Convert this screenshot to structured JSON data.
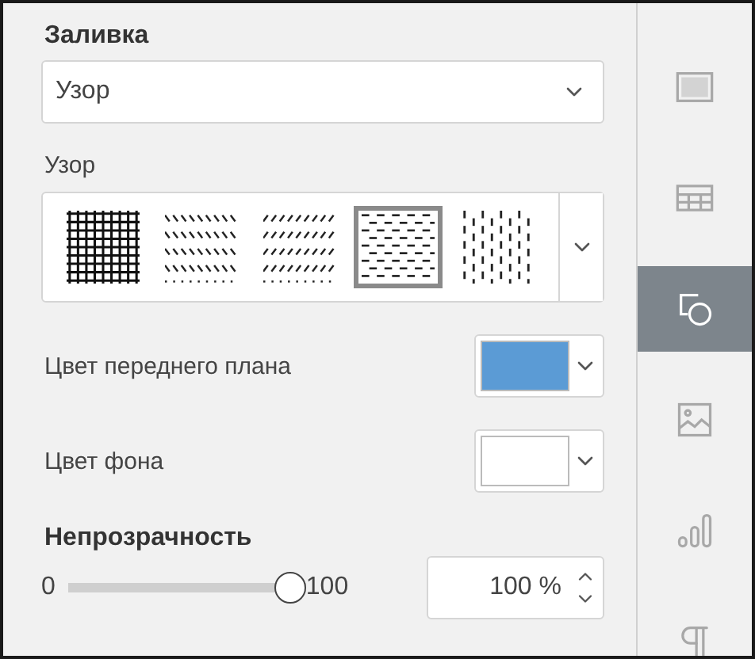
{
  "fill": {
    "title": "Заливка",
    "type_select": {
      "value": "Узор"
    }
  },
  "pattern": {
    "label": "Узор",
    "items": [
      {
        "kind": "grid",
        "selected": false
      },
      {
        "kind": "diagonal-down",
        "selected": false
      },
      {
        "kind": "diagonal-up",
        "selected": false
      },
      {
        "kind": "dashed-horizontal",
        "selected": true
      },
      {
        "kind": "dashed-vertical",
        "selected": false
      }
    ]
  },
  "foreground": {
    "label": "Цвет переднего плана",
    "color": "#5b9bd5"
  },
  "background": {
    "label": "Цвет фона",
    "color": "#ffffff"
  },
  "opacity": {
    "title": "Непрозрачность",
    "min": "0",
    "max": "100",
    "level": 1,
    "value": "100 %"
  },
  "sidebar": [
    {
      "kind": "slide",
      "selected": false
    },
    {
      "kind": "table",
      "selected": false
    },
    {
      "kind": "shape",
      "selected": true
    },
    {
      "kind": "image",
      "selected": false
    },
    {
      "kind": "chart",
      "selected": false
    },
    {
      "kind": "paragraph",
      "selected": false
    }
  ]
}
